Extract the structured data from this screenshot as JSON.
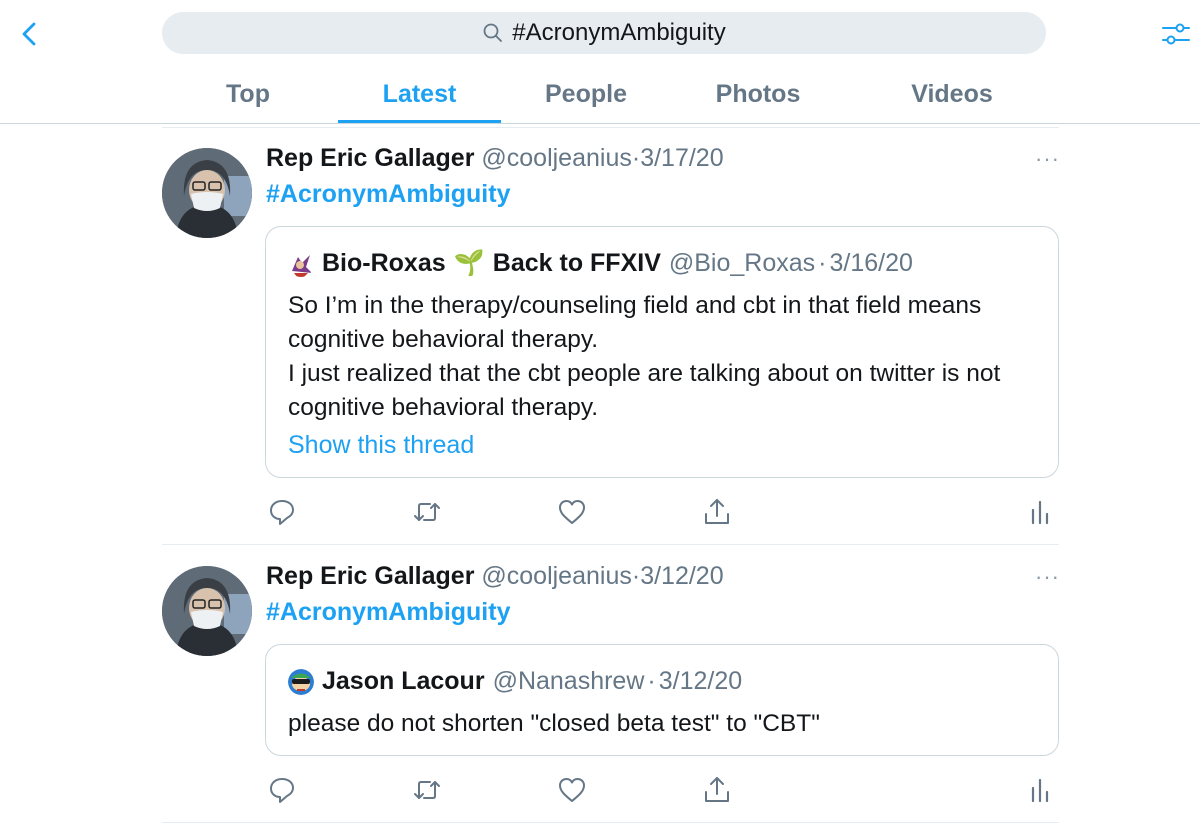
{
  "search": {
    "query": "#AcronymAmbiguity"
  },
  "tabs": [
    {
      "label": "Top",
      "active": false
    },
    {
      "label": "Latest",
      "active": true
    },
    {
      "label": "People",
      "active": false
    },
    {
      "label": "Photos",
      "active": false
    },
    {
      "label": "Videos",
      "active": false
    }
  ],
  "colors": {
    "accent": "#1da1f2",
    "secondary_text": "#657786",
    "border": "#ccd6dd"
  },
  "tweets": [
    {
      "name": "Rep Eric Gallager",
      "handle": "@cooljeanius",
      "separator": "·",
      "date": "3/17/20",
      "more": "···",
      "text": "#AcronymAmbiguity",
      "quote": {
        "name": "Bio-Roxas",
        "name_emoji": "🌱",
        "name_suffix": "Back to FFXIV",
        "handle": "@Bio_Roxas",
        "separator": "·",
        "date": "3/16/20",
        "lines": [
          "So I’m in the therapy/counseling field and cbt in that field means",
          "cognitive behavioral therapy.",
          "I just realized that the cbt people are talking about on twitter is not",
          "cognitive behavioral therapy."
        ],
        "link": "Show this thread"
      }
    },
    {
      "name": "Rep Eric Gallager",
      "handle": "@cooljeanius",
      "separator": "·",
      "date": "3/12/20",
      "more": "···",
      "text": "#AcronymAmbiguity",
      "quote": {
        "name": "Jason Lacour",
        "handle": "@Nanashrew",
        "separator": "·",
        "date": "3/12/20",
        "lines": [
          "please do not shorten \"closed beta test\" to \"CBT\""
        ]
      }
    }
  ],
  "icons": [
    "back-chevron-icon",
    "search-icon",
    "filter-sliders-icon",
    "reply-icon",
    "retweet-icon",
    "like-icon",
    "share-icon",
    "analytics-icon"
  ]
}
